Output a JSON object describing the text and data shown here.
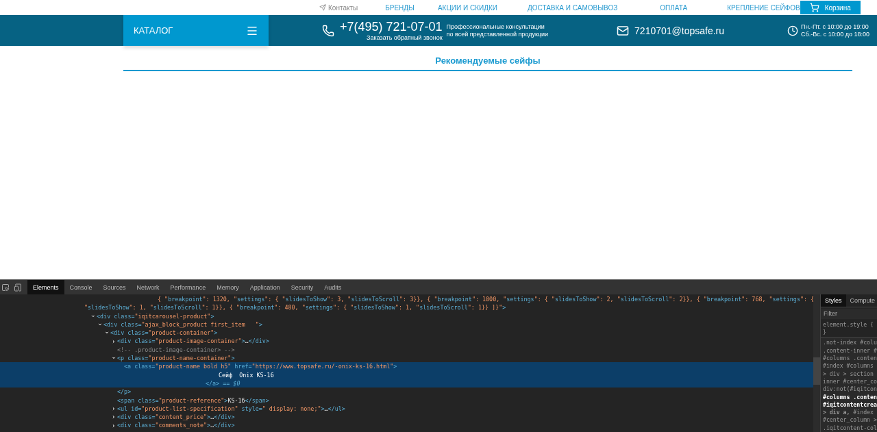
{
  "top_nav": {
    "links": [
      {
        "label": "Контакты",
        "kind": "with_icon"
      },
      {
        "label": "БРЕНДЫ",
        "kind": "plain"
      },
      {
        "label": "АКЦИИ И СКИДКИ",
        "kind": "plain"
      },
      {
        "label": "ДОСТАВКА И САМОВЫВОЗ",
        "kind": "plain"
      },
      {
        "label": "ОПЛАТА",
        "kind": "plain"
      },
      {
        "label": "КРЕПЛЕНИЕ СЕЙФОВ",
        "kind": "plain"
      }
    ],
    "cart": {
      "label": "Корзина"
    }
  },
  "header_bar": {
    "catalog": {
      "label": "КАТАЛОГ"
    },
    "phone": {
      "number": "+7(495) 721-07-01",
      "callback": "Заказать обратный звонок"
    },
    "consult": [
      "Профессиональные консультации",
      "по всей представленной продукции"
    ],
    "email": "7210701@topsafe.ru",
    "hours": [
      "Пн.-Пт. с 10:00 до 19:00",
      "Сб.-Вс. с 10:00 до 18:00"
    ]
  },
  "section_title": "Рекомендуемые сейфы",
  "devtools": {
    "tabs": [
      {
        "label": "Elements",
        "selected": true
      },
      {
        "label": "Console",
        "selected": false
      },
      {
        "label": "Sources",
        "selected": false
      },
      {
        "label": "Network",
        "selected": false
      },
      {
        "label": "Performance",
        "selected": false
      },
      {
        "label": "Memory",
        "selected": false
      },
      {
        "label": "Application",
        "selected": false
      },
      {
        "label": "Security",
        "selected": false
      },
      {
        "label": "Audits",
        "selected": false
      }
    ],
    "elements": {
      "attribute_overflow": [
        "{ \"breakpoint\": 1320, \"settings\": { \"slidesToShow\": 3, \"slidesToScroll\": 3}}, { \"breakpoint\": 1000, \"settings\": { \"slidesToShow\": 2, \"slidesToScroll\": 2}}, { \"breakpoint\": 768, \"settings\": {",
        "\"slidesToShow\": 1, \"slidesToScroll\": 1}}, { \"breakpoint\": 480, \"settings\": { \"slidesToShow\": 1, \"slidesToScroll\": 1}} ]}\">"
      ],
      "nodes": [
        {
          "kind": "expanded",
          "markup": "<div class=\"iqitcarousel-product\">",
          "selected": false,
          "children": [
            {
              "kind": "expanded",
              "markup": "<div class=\"ajax_block_product first_item   \">",
              "selected": false,
              "children": [
                {
                  "kind": "expanded",
                  "markup": "<div class=\"product-container\">",
                  "selected": false,
                  "children": [
                    {
                      "kind": "collapsed",
                      "markup": "<div class=\"product-image-container\">…</div>",
                      "selected": false
                    },
                    {
                      "kind": "comment",
                      "markup": "<!-- .product-image-container> -->",
                      "selected": false
                    },
                    {
                      "kind": "expanded",
                      "markup": "<p class=\"product-name-container\">",
                      "selected": false,
                      "close": "</p>",
                      "children": [
                        {
                          "kind": "leaf",
                          "markup": "<a class=\"product-name bold h5\" href=\"https://www.topsafe.ru/-onix-ks-16.html\">",
                          "selected": true,
                          "inner": "Сейф  Onix KS-16",
                          "close": "</a> == *$0*"
                        }
                      ]
                    },
                    {
                      "kind": "leaf",
                      "markup": "<span class=\"product-reference\">KS-16</span>",
                      "selected": false
                    },
                    {
                      "kind": "collapsed",
                      "markup": "<ul id=\"product-list-specification\" style=\" display: none;\">…</ul>",
                      "selected": false
                    },
                    {
                      "kind": "collapsed",
                      "markup": "<div class=\"content_price\">…</div>",
                      "selected": false
                    },
                    {
                      "kind": "collapsed",
                      "markup": "<div class=\"comments_note\">…</div>",
                      "selected": false
                    }
                  ]
                }
              ]
            }
          ]
        }
      ]
    },
    "styles_pane": {
      "tabs": [
        {
          "label": "Styles",
          "selected": true
        },
        {
          "label": "Compute",
          "selected": false
        }
      ],
      "filter": {
        "placeholder": "Filter"
      },
      "element_style": [
        "element.style {",
        "}"
      ],
      "rules": [
        {
          "text": ".not-index #colu",
          "bold": false
        },
        {
          "text": ".content-inner #",
          "bold": false
        },
        {
          "text": "#columns .conten",
          "bold": false
        },
        {
          "text": "#index #columns ",
          "bold": false
        },
        {
          "text": "> div > section ",
          "bold": false
        },
        {
          "text": "inner #center_co",
          "bold": false
        },
        {
          "text": "div:not(#iqitcon",
          "bold": false
        },
        {
          "text": "#columns .conten",
          "bold": true
        },
        {
          "text": "#iqitcontentcrea",
          "bold": true
        },
        {
          "text": "**> div a,** #index ",
          "bold": false
        },
        {
          "text": "#center_column >",
          "bold": false
        },
        {
          "text": ".iqitcontent-col",
          "bold": false
        }
      ]
    }
  }
}
